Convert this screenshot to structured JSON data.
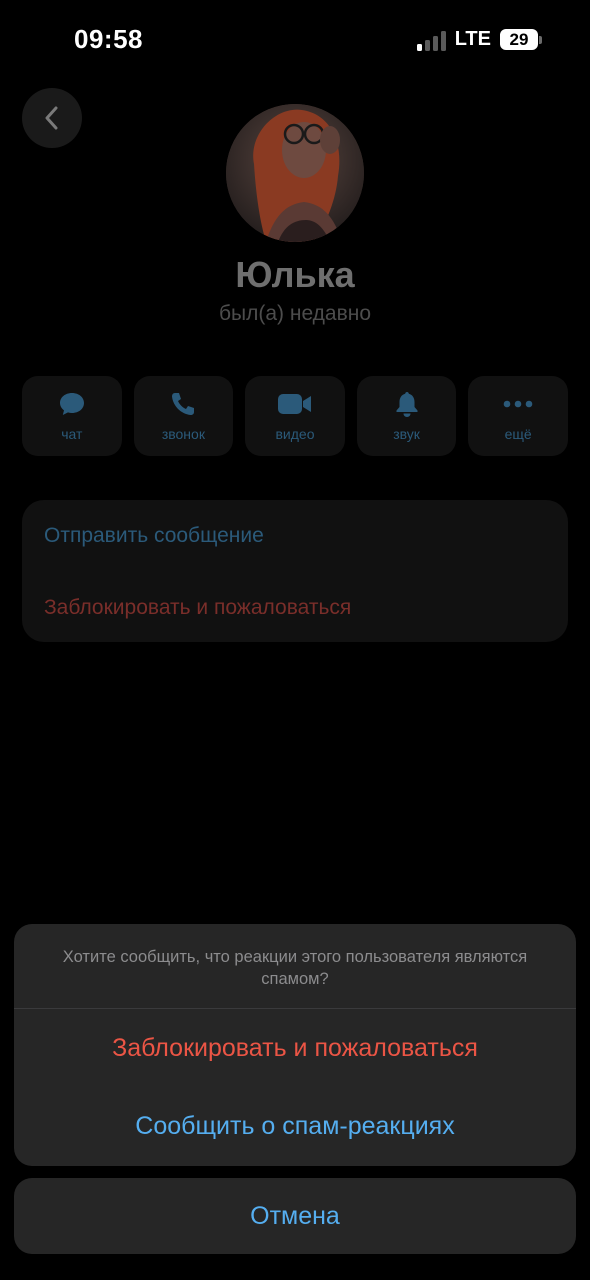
{
  "status_bar": {
    "time": "09:58",
    "network": "LTE",
    "battery": "29"
  },
  "profile": {
    "name": "Юлька",
    "status": "был(а) недавно",
    "actions": [
      {
        "label": "чат",
        "icon": "chat-bubble-icon"
      },
      {
        "label": "звонок",
        "icon": "phone-icon"
      },
      {
        "label": "видео",
        "icon": "video-camera-icon"
      },
      {
        "label": "звук",
        "icon": "bell-icon"
      },
      {
        "label": "ещё",
        "icon": "more-dots-icon"
      }
    ],
    "options": {
      "send_message": "Отправить сообщение",
      "block_report": "Заблокировать и пожаловаться"
    }
  },
  "action_sheet": {
    "message": "Хотите сообщить, что реакции этого пользователя являются спамом?",
    "block_report": "Заблокировать и пожаловаться",
    "report_spam_reactions": "Сообщить о спам-реакциях",
    "cancel": "Отмена"
  },
  "colors": {
    "accent_blue": "#55aef0",
    "destructive_red": "#eb5545",
    "sheet_background": "#262626"
  }
}
